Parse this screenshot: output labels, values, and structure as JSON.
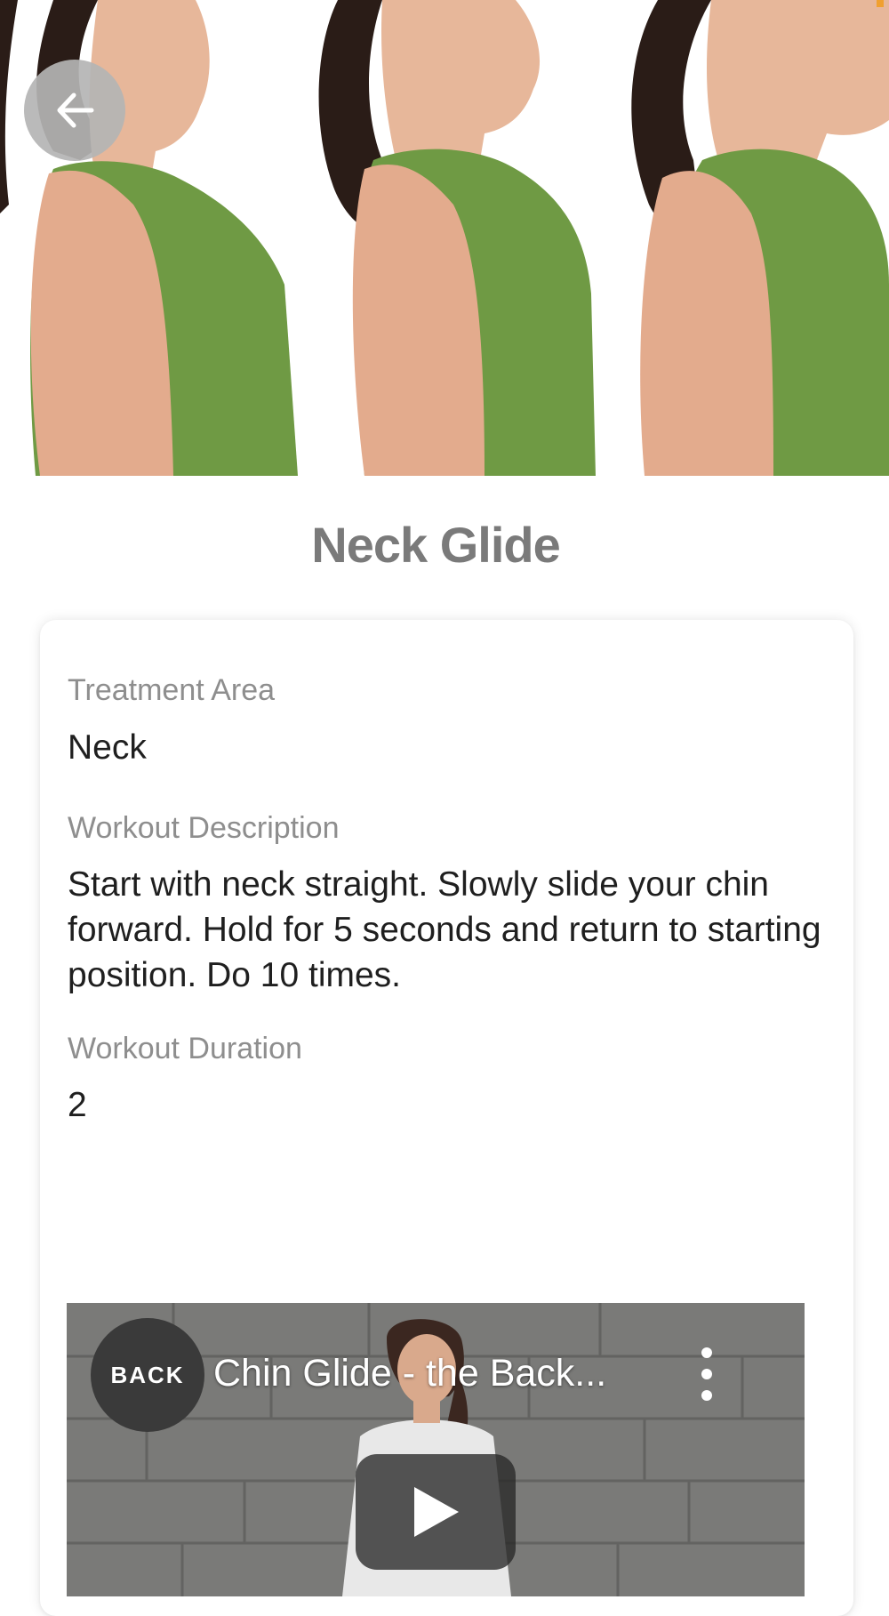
{
  "header": {
    "back_icon": "arrow-left-icon",
    "hero_image": "three-step neck posture photo"
  },
  "exercise": {
    "title": "Neck Glide"
  },
  "details": {
    "treatment_area_label": "Treatment Area",
    "treatment_area_value": "Neck",
    "description_label": "Workout Description",
    "description_value": "Start with neck straight. Slowly slide your chin forward. Hold for 5 seconds and return to starting position. Do 10 times.",
    "duration_label": "Workout Duration",
    "duration_value": "2"
  },
  "video": {
    "channel_badge": "BACK",
    "title": "Chin Glide - the Back...",
    "menu_icon": "more-vertical-icon",
    "play_icon": "play-icon"
  },
  "colors": {
    "title": "#7a7a7a",
    "label": "#8e8e8e",
    "value": "#1f1f1f",
    "tank_top": "#6f9a44",
    "back_button": "#b4b4b4"
  }
}
